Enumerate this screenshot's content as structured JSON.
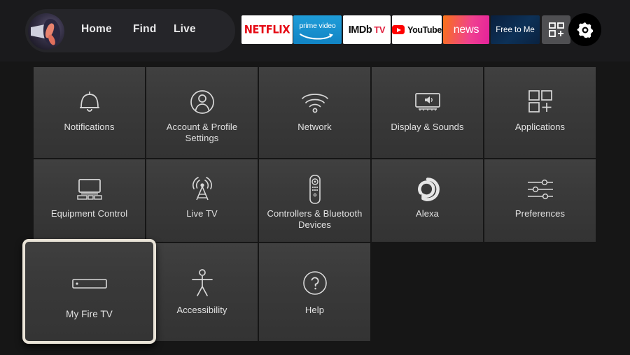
{
  "topbar": {
    "avatar_name": "profile-avatar",
    "nav": [
      {
        "label": "Home",
        "name": "nav-home"
      },
      {
        "label": "Find",
        "name": "nav-find"
      },
      {
        "label": "Live",
        "name": "nav-live"
      }
    ],
    "apps": [
      {
        "label": "NETFLIX",
        "name": "app-netflix",
        "bg": "#ffffff",
        "fg": "#e50914"
      },
      {
        "label": "prime video",
        "name": "app-prime-video",
        "bg": "#1189c9",
        "fg": "#ffffff"
      },
      {
        "label": "IMDb",
        "label2": "TV",
        "name": "app-imdb-tv",
        "bg": "#ffffff",
        "fg": "#0d0d0d"
      },
      {
        "label": "YouTube",
        "name": "app-youtube",
        "bg": "#ffffff",
        "fg": "#0d0d0d"
      },
      {
        "label": "news",
        "name": "app-news",
        "bg": "#f0418f",
        "fg": "#ffffff"
      },
      {
        "label": "Free to Me",
        "name": "app-free-to-me",
        "bg": "#0d3157",
        "fg": "#ffffff"
      }
    ],
    "grid_button": "app-grid-icon",
    "settings_button": "gear-icon"
  },
  "settings": {
    "rows": [
      [
        {
          "label": "Notifications",
          "icon": "bell-icon"
        },
        {
          "label": "Account & Profile Settings",
          "icon": "person-circle-icon"
        },
        {
          "label": "Network",
          "icon": "wifi-icon"
        },
        {
          "label": "Display & Sounds",
          "icon": "tv-speaker-icon"
        },
        {
          "label": "Applications",
          "icon": "app-squares-plus-icon"
        }
      ],
      [
        {
          "label": "Equipment Control",
          "icon": "tv-soundbar-icon"
        },
        {
          "label": "Live TV",
          "icon": "broadcast-tower-icon"
        },
        {
          "label": "Controllers & Bluetooth Devices",
          "icon": "remote-control-icon"
        },
        {
          "label": "Alexa",
          "icon": "alexa-ring-icon"
        },
        {
          "label": "Preferences",
          "icon": "sliders-icon"
        }
      ],
      [
        {
          "label": "Accessibility",
          "icon": "accessibility-person-icon"
        },
        {
          "label": "Help",
          "icon": "question-circle-icon"
        }
      ]
    ],
    "selected": {
      "label": "My Fire TV",
      "icon": "fire-tv-stick-icon"
    }
  },
  "colors": {
    "background": "#161616",
    "tile": "#3a3a3a",
    "selection_border": "#e9e3d7",
    "text": "#e2e2e2"
  }
}
